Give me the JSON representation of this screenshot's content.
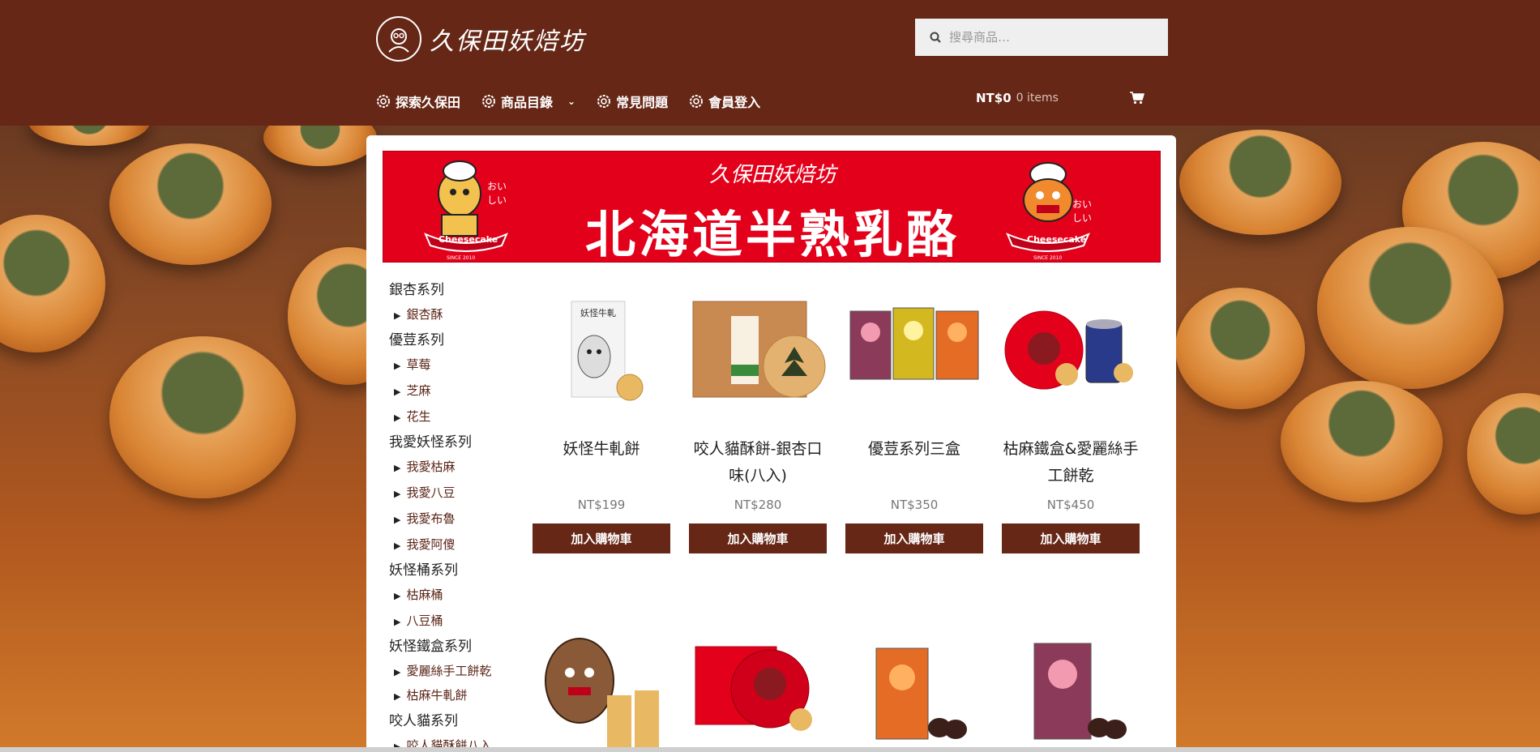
{
  "header": {
    "logo_text": "久保田妖焙坊",
    "search_placeholder": "搜尋商品…",
    "nav": [
      {
        "label": "探索久保田"
      },
      {
        "label": "商品目錄"
      },
      {
        "label": "常見問題"
      },
      {
        "label": "會員登入"
      }
    ],
    "cart": {
      "amount": "NT$0",
      "items": "0 items"
    }
  },
  "banner": {
    "brand": "久保田妖焙坊",
    "title": "北海道半熟乳酪",
    "oishii": "おいしい",
    "badge": "Cheesecake",
    "since": "SINCE 2010"
  },
  "sidebar": [
    {
      "category": "銀杏系列",
      "items": [
        "銀杏酥"
      ]
    },
    {
      "category": "優荳系列",
      "items": [
        "草莓",
        "芝麻",
        "花生"
      ]
    },
    {
      "category": "我愛妖怪系列",
      "items": [
        "我愛枯麻",
        "我愛八豆",
        "我愛布魯",
        "我愛阿傻"
      ]
    },
    {
      "category": "妖怪桶系列",
      "items": [
        "枯麻桶",
        "八豆桶"
      ]
    },
    {
      "category": "妖怪鐵盒系列",
      "items": [
        "愛麗絲手工餅乾",
        "枯麻牛軋餅"
      ]
    },
    {
      "category": "咬人貓系列",
      "items": [
        "咬人貓酥餅八入"
      ]
    }
  ],
  "products": [
    {
      "name": "妖怪牛軋餅",
      "price": "NT$199",
      "button": "加入購物車"
    },
    {
      "name": "咬人貓酥餅-銀杏口味(八入)",
      "price": "NT$280",
      "button": "加入購物車"
    },
    {
      "name": "優荳系列三盒",
      "price": "NT$350",
      "button": "加入購物車"
    },
    {
      "name": "枯麻鐵盒&愛麗絲手工餅乾",
      "price": "NT$450",
      "button": "加入購物車"
    }
  ],
  "colors": {
    "header": "#662716",
    "button": "#662716",
    "banner": "#e3001b"
  }
}
